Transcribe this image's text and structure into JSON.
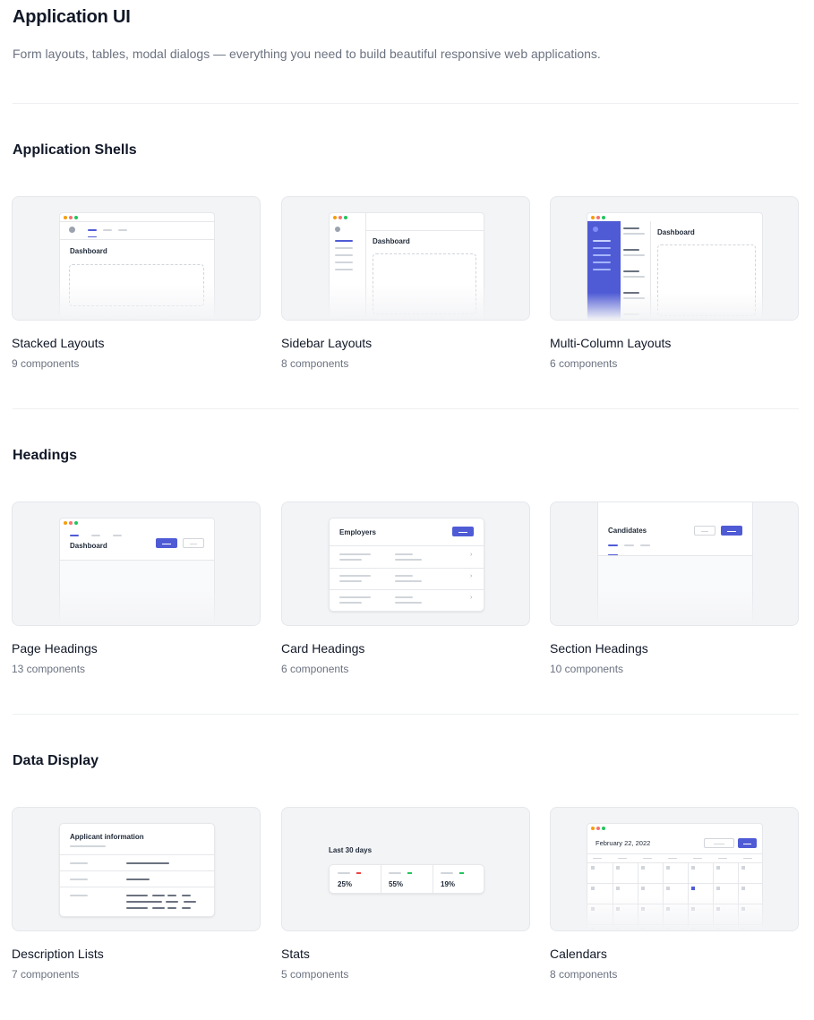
{
  "page": {
    "title": "Application UI",
    "description": "Form layouts, tables, modal dialogs — everything you need to build beautiful responsive web applications."
  },
  "sections": [
    {
      "title": "Application Shells",
      "cards": [
        {
          "title": "Stacked Layouts",
          "count": "9 components",
          "preview_label": "Dashboard"
        },
        {
          "title": "Sidebar Layouts",
          "count": "8 components",
          "preview_label": "Dashboard"
        },
        {
          "title": "Multi-Column Layouts",
          "count": "6 components",
          "preview_label": "Dashboard"
        }
      ]
    },
    {
      "title": "Headings",
      "cards": [
        {
          "title": "Page Headings",
          "count": "13 components",
          "preview_label": "Dashboard"
        },
        {
          "title": "Card Headings",
          "count": "6 components",
          "preview_label": "Employers"
        },
        {
          "title": "Section Headings",
          "count": "10 components",
          "preview_label": "Candidates"
        }
      ]
    },
    {
      "title": "Data Display",
      "cards": [
        {
          "title": "Description Lists",
          "count": "7 components",
          "preview_label": "Applicant information"
        },
        {
          "title": "Stats",
          "count": "5 components",
          "preview_label": "Last 30 days",
          "stats": [
            "25%",
            "55%",
            "19%"
          ]
        },
        {
          "title": "Calendars",
          "count": "8 components",
          "preview_label": "February 22, 2022"
        }
      ]
    }
  ],
  "colors": {
    "accent": "#4f5bd5",
    "muted_text": "#6b7280",
    "thumb_bg": "#f3f4f6"
  }
}
